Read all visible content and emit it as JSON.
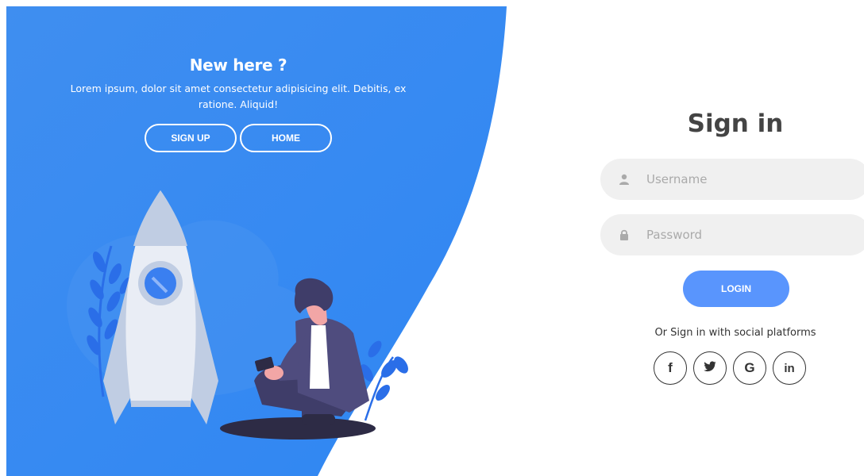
{
  "panel": {
    "title": "New here ?",
    "description": "Lorem ipsum, dolor sit amet consectetur adipisicing elit. Debitis, ex ratione. Aliquid!",
    "signup_label": "SIGN UP",
    "home_label": "HOME"
  },
  "signin": {
    "title": "Sign in",
    "username_placeholder": "Username",
    "password_placeholder": "Password",
    "login_label": "LOGIN",
    "social_text": "Or Sign in with social platforms",
    "social": [
      {
        "icon": "facebook-icon",
        "glyph": "f"
      },
      {
        "icon": "twitter-icon",
        "glyph": "bird"
      },
      {
        "icon": "google-icon",
        "glyph": "G"
      },
      {
        "icon": "linkedin-icon",
        "glyph": "in"
      }
    ]
  },
  "colors": {
    "primary": "#5995fd",
    "panel_gradient_start": "#4481eb",
    "panel_gradient_end": "#04befe",
    "field_bg": "#f0f0f0",
    "title_text": "#444444"
  }
}
